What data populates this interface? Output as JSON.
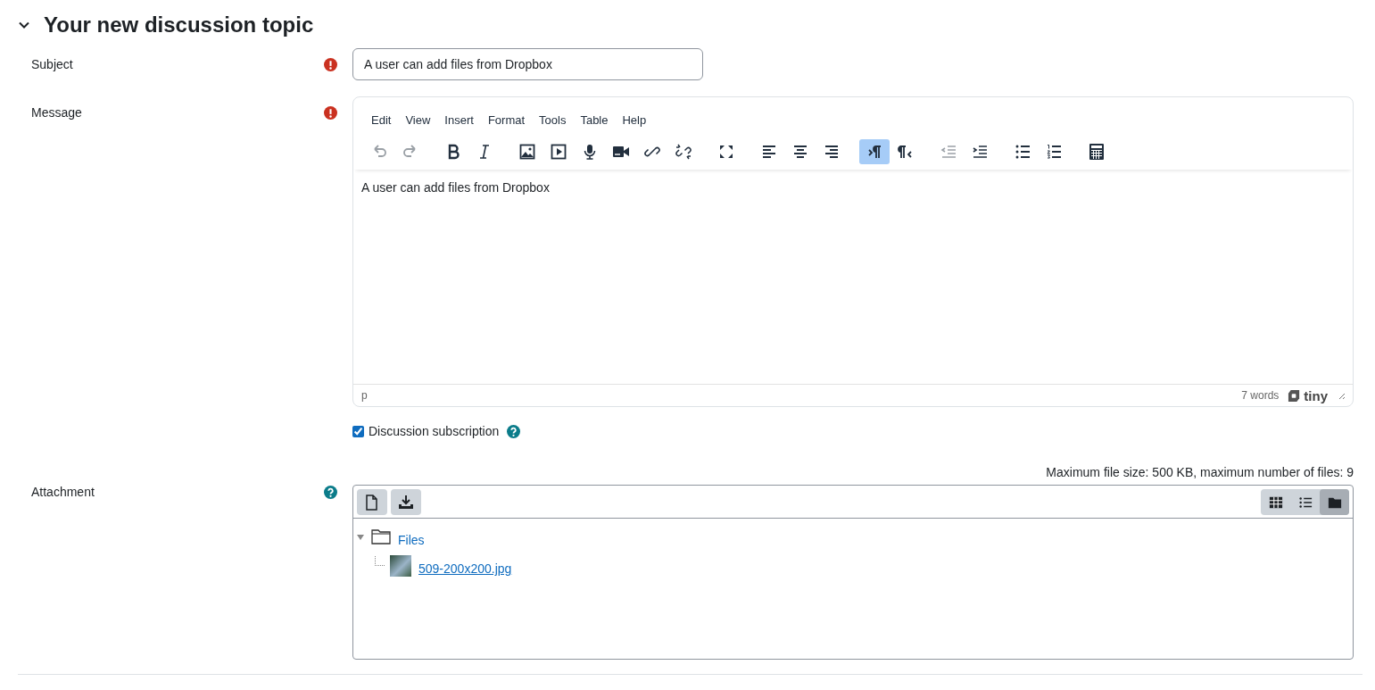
{
  "section": {
    "title": "Your new discussion topic",
    "expanded": true
  },
  "subject": {
    "label": "Subject",
    "marker": {
      "kind": "required"
    },
    "value": "A user can add files from Dropbox"
  },
  "message": {
    "label": "Message",
    "marker": {
      "kind": "required"
    },
    "menu": [
      "Edit",
      "View",
      "Insert",
      "Format",
      "Tools",
      "Table",
      "Help"
    ],
    "toolbar": [
      [
        {
          "kind": "undo",
          "disabled": true,
          "selected": false
        },
        {
          "kind": "redo",
          "disabled": true,
          "selected": false
        }
      ],
      [
        {
          "kind": "bold",
          "disabled": false,
          "selected": false
        },
        {
          "kind": "italic",
          "disabled": false,
          "selected": false
        }
      ],
      [
        {
          "kind": "image",
          "disabled": false,
          "selected": false
        },
        {
          "kind": "media",
          "disabled": false,
          "selected": false
        },
        {
          "kind": "microphone",
          "disabled": false,
          "selected": false
        },
        {
          "kind": "video",
          "disabled": false,
          "selected": false
        },
        {
          "kind": "link",
          "disabled": false,
          "selected": false
        },
        {
          "kind": "unlink",
          "disabled": false,
          "selected": false
        }
      ],
      [
        {
          "kind": "fullscreen",
          "disabled": false,
          "selected": false
        }
      ],
      [
        {
          "kind": "align-left",
          "disabled": false,
          "selected": false
        },
        {
          "kind": "align-center",
          "disabled": false,
          "selected": false
        },
        {
          "kind": "align-right",
          "disabled": false,
          "selected": false
        }
      ],
      [
        {
          "kind": "ltr",
          "disabled": false,
          "selected": true
        },
        {
          "kind": "rtl",
          "disabled": false,
          "selected": false
        }
      ],
      [
        {
          "kind": "outdent",
          "disabled": true,
          "selected": false
        },
        {
          "kind": "indent",
          "disabled": false,
          "selected": false
        }
      ],
      [
        {
          "kind": "bullets",
          "disabled": false,
          "selected": false
        },
        {
          "kind": "numbers",
          "disabled": false,
          "selected": false
        }
      ],
      [
        {
          "kind": "calculator",
          "disabled": false,
          "selected": false
        }
      ]
    ],
    "content": "A user can add files from Dropbox",
    "path": "p",
    "word_count": "7 words",
    "brand": "tiny"
  },
  "subscription": {
    "label": "Discussion subscription",
    "checked": true
  },
  "attachment": {
    "label": "Attachment",
    "marker": {
      "kind": "help"
    },
    "limits": "Maximum file size: 500 KB, maximum number of files: 9",
    "actions": [
      {
        "kind": "add-file"
      },
      {
        "kind": "download"
      }
    ],
    "views": [
      {
        "kind": "grid",
        "selected": false
      },
      {
        "kind": "list",
        "selected": false
      },
      {
        "kind": "tree",
        "selected": true
      }
    ],
    "tree": [
      {
        "label": "Files",
        "kind": "folder",
        "expanded": true,
        "children": [
          {
            "label": "509-200x200.jpg",
            "kind": "image"
          }
        ]
      }
    ]
  }
}
